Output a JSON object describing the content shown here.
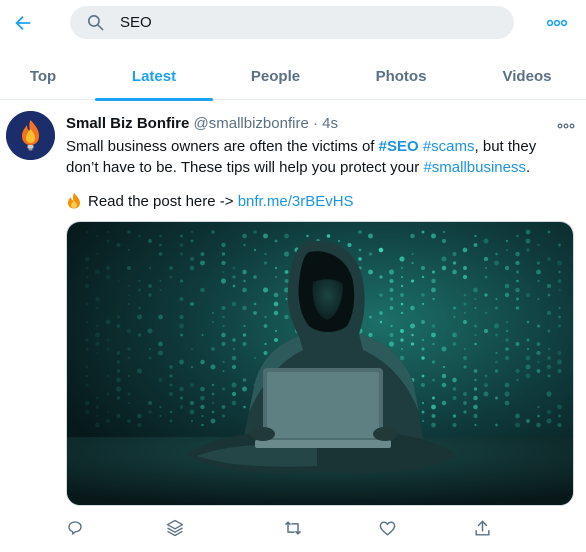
{
  "search": {
    "value": "SEO"
  },
  "tabs": [
    {
      "label": "Top"
    },
    {
      "label": "Latest"
    },
    {
      "label": "People"
    },
    {
      "label": "Photos"
    },
    {
      "label": "Videos"
    }
  ],
  "active_tab": "Latest",
  "tweet": {
    "name": "Small Biz Bonfire",
    "handle": "@smallbizbonfire",
    "separator": "·",
    "time": "4s",
    "text_part1": "Small business owners are often the victims of ",
    "hashtag_seo": "#SEO",
    "text_space": " ",
    "hashtag_scams": "#scams",
    "text_part2": ", but they don’t have to be. These tips will help you protect your ",
    "hashtag_smallbusiness": "#smallbusiness",
    "text_part3": ".",
    "read_label": "Read the post here ->",
    "link": "bnfr.me/3rBEvHS"
  },
  "icons": {
    "back": "back-arrow-icon",
    "search": "search-icon",
    "more": "more-icon",
    "caret": "caret-icon",
    "reply": "reply-icon",
    "stack": "stack-icon",
    "retweet": "retweet-icon",
    "like": "like-icon",
    "share": "share-icon"
  },
  "colors": {
    "accent": "#1da1f2",
    "link": "#1b95e0",
    "muted": "#5b7083",
    "search_bg": "#ebeef0",
    "media_teal": "#2ec4a6"
  }
}
